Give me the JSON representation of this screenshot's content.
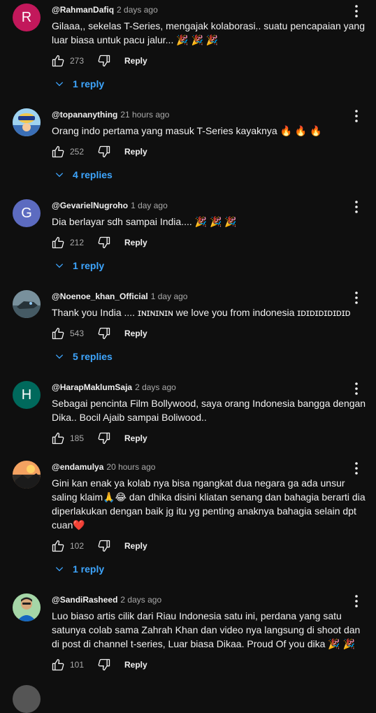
{
  "comments": [
    {
      "author": "@RahmanDafiq",
      "time": "2 days ago",
      "avatar_letter": "R",
      "avatar_color": "#c2185b",
      "text": "Gilaaa,, sekelas T-Series, mengajak kolaborasi.. suatu pencapaian yang luar biasa untuk pacu jalur... 🎉 🎉 🎉",
      "likes": "273",
      "reply_label": "Reply",
      "replies_label": "1 reply"
    },
    {
      "author": "@topananything",
      "time": "21 hours ago",
      "avatar_letter": "",
      "text": "Orang indo pertama yang masuk T-Series kayaknya 🔥 🔥 🔥",
      "likes": "252",
      "reply_label": "Reply",
      "replies_label": "4 replies"
    },
    {
      "author": "@GevarielNugroho",
      "time": "1 day ago",
      "avatar_letter": "G",
      "avatar_color": "#5c6bc0",
      "text": "Dia berlayar sdh sampai India.... 🎉 🎉 🎉",
      "likes": "212",
      "reply_label": "Reply",
      "replies_label": "1 reply"
    },
    {
      "author": "@Noenoe_khan_Official",
      "time": "1 day ago",
      "avatar_letter": "",
      "text": "Thank you India .... ɪɴɪɴɪɴɪɴ we love you from indonesia ɪᴅɪᴅɪᴅɪᴅɪᴅɪᴅ",
      "likes": "543",
      "reply_label": "Reply",
      "replies_label": "5 replies"
    },
    {
      "author": "@HarapMaklumSaja",
      "time": "2 days ago",
      "avatar_letter": "H",
      "avatar_color": "#00695c",
      "text": "Sebagai pencinta Film Bollywood, saya orang Indonesia bangga dengan Dika.. Bocil Ajaib sampai Boliwood..",
      "likes": "185",
      "reply_label": "Reply",
      "replies_label": ""
    },
    {
      "author": "@endamulya",
      "time": "20 hours ago",
      "avatar_letter": "",
      "text": "Gini kan enak ya kolab nya bisa ngangkat dua negara ga ada unsur saling klaim🙏😂 dan dhika disini kliatan senang dan bahagia berarti dia diperlakukan dengan baik jg itu yg penting anaknya bahagia selain dpt cuan❤️",
      "likes": "102",
      "reply_label": "Reply",
      "replies_label": "1 reply"
    },
    {
      "author": "@SandiRasheed",
      "time": "2 days ago",
      "avatar_letter": "",
      "text": "Luo biaso artis cilik dari Riau Indonesia satu ini, perdana yang satu satunya colab sama Zahrah Khan dan video nya langsung di shoot dan di post di channel t-series, Luar biasa Dikaa. Proud Of you dika 🎉 🎉",
      "likes": "101",
      "reply_label": "Reply",
      "replies_label": ""
    }
  ]
}
